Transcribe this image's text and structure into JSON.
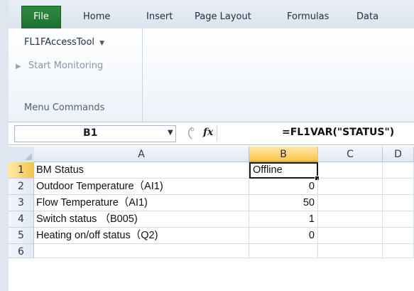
{
  "ribbon_tabs": [
    "File",
    "Home",
    "Insert",
    "Page Layout",
    "Formulas",
    "Data"
  ],
  "ribbon": {
    "addin_menu": "FL1FAccessTool",
    "start_monitoring": "Start Monitoring",
    "group_label": "Menu Commands"
  },
  "formula_bar": {
    "name_box": "B1",
    "fx_label": "fx",
    "formula": "=FL1VAR(\"STATUS\")"
  },
  "sheet": {
    "columns": [
      "A",
      "B",
      "C",
      "D"
    ],
    "rows": [
      {
        "num": "1",
        "a": "BM Status",
        "b": "Offline"
      },
      {
        "num": "2",
        "a": "Outdoor Temperature（AI1)",
        "b": "0"
      },
      {
        "num": "3",
        "a": "Flow Temperature（AI1)",
        "b": "50"
      },
      {
        "num": "4",
        "a": "Switch status （B005)",
        "b": "1"
      },
      {
        "num": "5",
        "a": "Heating on/off status（Q2)",
        "b": "0"
      },
      {
        "num": "6",
        "a": "",
        "b": ""
      }
    ]
  },
  "colors": {
    "file_tab": "#1f6f31",
    "selection_header": "#f6c54b"
  }
}
